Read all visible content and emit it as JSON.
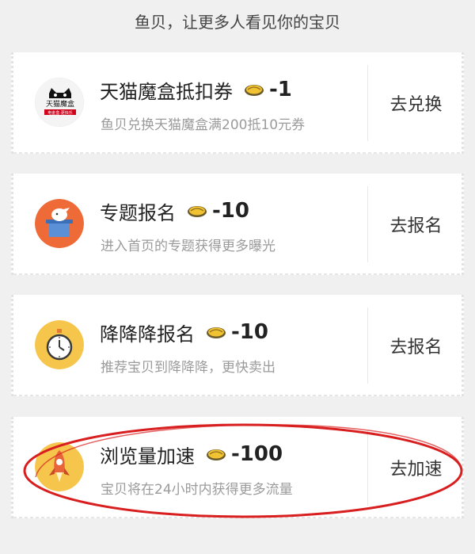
{
  "header": {
    "text": "鱼贝，让更多人看见你的宝贝"
  },
  "cards": [
    {
      "title": "天猫魔盒抵扣券",
      "cost": "-1",
      "desc": "鱼贝兑换天猫魔盒满200抵10元券",
      "action": "去兑换",
      "icon": "tmall-box-icon",
      "logo": {
        "line1": "天猫魔盒",
        "line2": "电金盒·更快乐"
      }
    },
    {
      "title": "专题报名",
      "cost": "-10",
      "desc": "进入首页的专题获得更多曝光",
      "action": "去报名",
      "icon": "magic-hat-icon"
    },
    {
      "title": "降降降报名",
      "cost": "-10",
      "desc": "推荐宝贝到降降降，更快卖出",
      "action": "去报名",
      "icon": "stopwatch-icon"
    },
    {
      "title": "浏览量加速",
      "cost": "-100",
      "desc": "宝贝将在24小时内获得更多流量",
      "action": "去加速",
      "icon": "rocket-icon"
    }
  ],
  "colors": {
    "background": "#f0f0f0",
    "card": "#ffffff",
    "hat_bg": "#ee6a37",
    "watch_bg": "#f6c64c",
    "rocket_bg": "#f6c64c",
    "annotation": "#d81e1e"
  }
}
